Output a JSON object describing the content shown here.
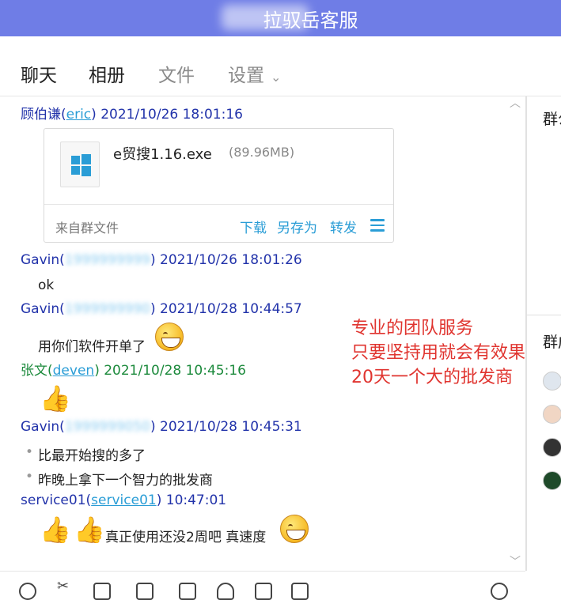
{
  "window": {
    "title": "拉驭岳客服"
  },
  "tabs": [
    {
      "label": "聊天"
    },
    {
      "label": "相册"
    },
    {
      "label": "文件"
    },
    {
      "label": "设置"
    }
  ],
  "messages": {
    "m1": {
      "name": "顾伯谦",
      "uid": "eric",
      "time": "2021/10/26 18:01:16"
    },
    "file": {
      "name": "e贸搜1.16.exe",
      "size": "(89.96MB)",
      "source": "来自群文件",
      "actions": {
        "download": "下载",
        "save_as": "另存为",
        "forward": "转发"
      }
    },
    "m2": {
      "name": "Gavin",
      "uid": "1999999999",
      "time": "2021/10/26 18:01:26",
      "text": "ok"
    },
    "m3": {
      "name": "Gavin",
      "uid": "1999999990",
      "time": "2021/10/28 10:44:57",
      "text": "用你们软件开单了"
    },
    "m4": {
      "name": "张文",
      "uid": "deven",
      "time": "2021/10/28 10:45:16"
    },
    "m5": {
      "name": "Gavin",
      "uid": "1999999050",
      "time": "2021/10/28 10:45:31",
      "lines": [
        "比最开始搜的多了",
        "昨晚上拿下一个智力的批发商"
      ]
    },
    "m6": {
      "name": "service01",
      "uid": "service01",
      "time": "10:47:01",
      "text": "真正使用还没2周吧  真速度"
    }
  },
  "annotation": {
    "lines": [
      "专业的团队服务",
      "只要坚持用就会有效果",
      "20天一个大的批发商"
    ],
    "color": "#e0342f"
  },
  "right_panel": {
    "label1": "群公告",
    "label2": "群成员"
  },
  "colors": {
    "titlebar": "#6f7de6",
    "link": "#2a9dd6",
    "sender": "#2233aa",
    "sender_green": "#1c8a3c"
  }
}
